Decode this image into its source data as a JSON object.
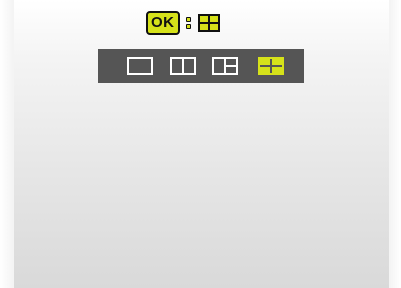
{
  "hint": {
    "key_label": "OK",
    "icon": "quad-view-icon"
  },
  "layout_options": [
    {
      "name": "single-view",
      "icon": "single-view-icon",
      "selected": false
    },
    {
      "name": "dual-view",
      "icon": "dual-view-icon",
      "selected": false
    },
    {
      "name": "triple-view",
      "icon": "triple-view-icon",
      "selected": false
    },
    {
      "name": "quad-view",
      "icon": "quad-view-icon",
      "selected": true
    }
  ],
  "colors": {
    "accent": "#d6e21a",
    "toolbar_bg": "#555555",
    "icon_border": "#ffffff",
    "icon_fill": "#555555",
    "selected_fill": "#d6e21a",
    "selected_border": "#d6e21a",
    "selected_divider": "#555555"
  }
}
